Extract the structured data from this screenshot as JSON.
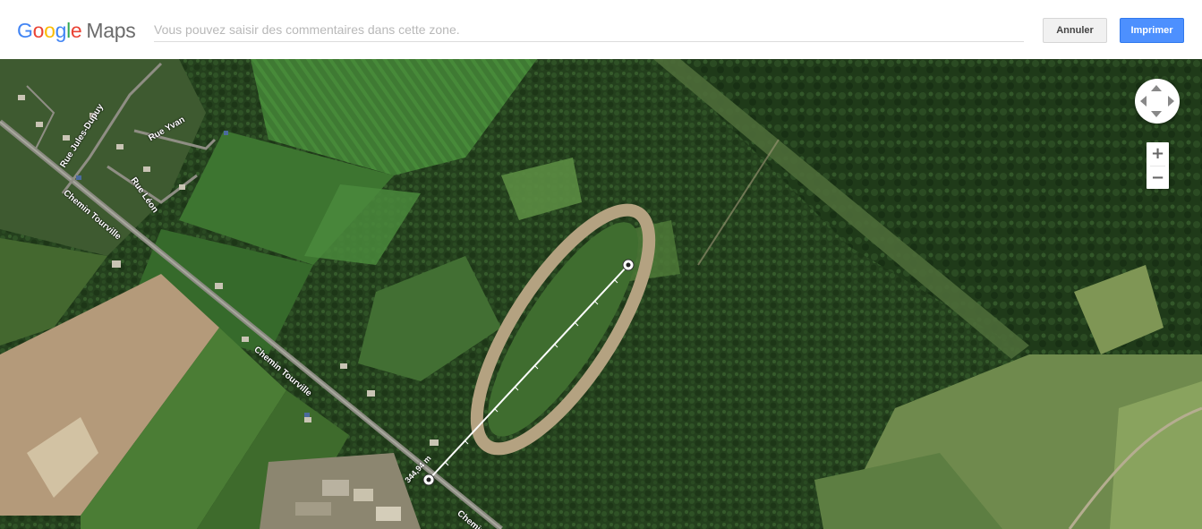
{
  "header": {
    "logo": {
      "letters": [
        {
          "char": "G",
          "color": "#4285F4"
        },
        {
          "char": "o",
          "color": "#EA4335"
        },
        {
          "char": "o",
          "color": "#FBBC05"
        },
        {
          "char": "g",
          "color": "#4285F4"
        },
        {
          "char": "l",
          "color": "#34A853"
        },
        {
          "char": "e",
          "color": "#EA4335"
        }
      ],
      "product": "Maps"
    },
    "comment_placeholder": "Vous pouvez saisir des commentaires dans cette zone.",
    "comment_value": "",
    "cancel_label": "Annuler",
    "print_label": "Imprimer"
  },
  "map": {
    "view": "satellite",
    "road_labels": {
      "jules_dupuy": "Rue Jules-Dupuy",
      "yvan": "Rue Yvan",
      "leon": "Rue Léon",
      "tourville_1": "Chemin Tourville",
      "tourville_2": "Chemin Tourville",
      "tourville_3": "Chemin"
    },
    "measurement": {
      "distance_text": "344,94 m"
    },
    "controls": {
      "pan_icon": "pan-arrows-icon",
      "zoom_in_label": "+",
      "zoom_out_label": "−"
    }
  },
  "colors": {
    "print_button": "#4d90fe",
    "map_base": "#2c4a24"
  }
}
